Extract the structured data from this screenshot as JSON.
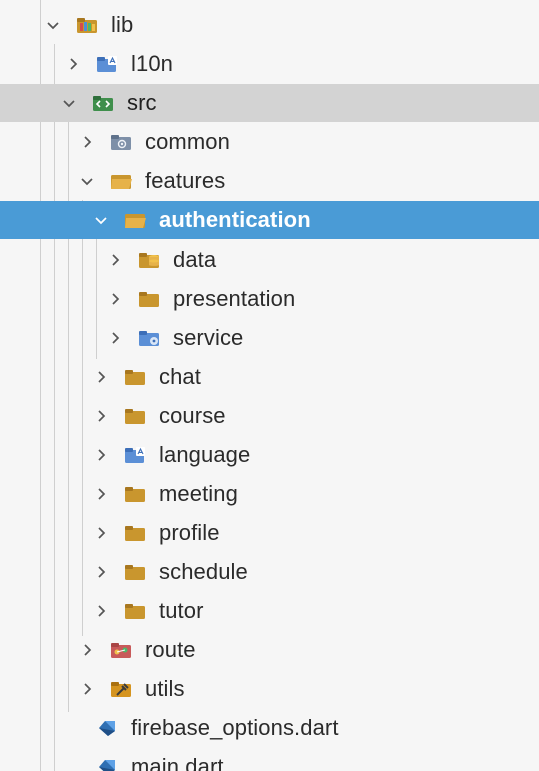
{
  "tree": {
    "items": [
      {
        "label": "lib",
        "state": "expanded",
        "icon": "folder-lib-icon"
      },
      {
        "label": "l10n",
        "state": "collapsed",
        "icon": "folder-localization-icon"
      },
      {
        "label": "src",
        "state": "expanded",
        "icon": "folder-src-icon"
      },
      {
        "label": "common",
        "state": "collapsed",
        "icon": "folder-common-icon"
      },
      {
        "label": "features",
        "state": "expanded",
        "icon": "folder-open-icon"
      },
      {
        "label": "authentication",
        "state": "expanded",
        "icon": "folder-open-icon"
      },
      {
        "label": "data",
        "state": "collapsed",
        "icon": "folder-data-icon"
      },
      {
        "label": "presentation",
        "state": "collapsed",
        "icon": "folder-icon"
      },
      {
        "label": "service",
        "state": "collapsed",
        "icon": "folder-service-icon"
      },
      {
        "label": "chat",
        "state": "collapsed",
        "icon": "folder-icon"
      },
      {
        "label": "course",
        "state": "collapsed",
        "icon": "folder-icon"
      },
      {
        "label": "language",
        "state": "collapsed",
        "icon": "folder-localization-icon"
      },
      {
        "label": "meeting",
        "state": "collapsed",
        "icon": "folder-icon"
      },
      {
        "label": "profile",
        "state": "collapsed",
        "icon": "folder-icon"
      },
      {
        "label": "schedule",
        "state": "collapsed",
        "icon": "folder-icon"
      },
      {
        "label": "tutor",
        "state": "collapsed",
        "icon": "folder-icon"
      },
      {
        "label": "route",
        "state": "collapsed",
        "icon": "folder-route-icon"
      },
      {
        "label": "utils",
        "state": "collapsed",
        "icon": "folder-utils-icon"
      },
      {
        "label": "firebase_options.dart",
        "state": "file",
        "icon": "dart-file-icon"
      },
      {
        "label": "main.dart",
        "state": "file",
        "icon": "dart-file-icon"
      }
    ],
    "selected": "authentication",
    "highlighted": "src"
  },
  "colors": {
    "background": "#f6f6f6",
    "selection": "#4a9bd6",
    "highlight": "#d3d3d3",
    "folder": "#c9962e",
    "dart": "#2f6fb2"
  }
}
